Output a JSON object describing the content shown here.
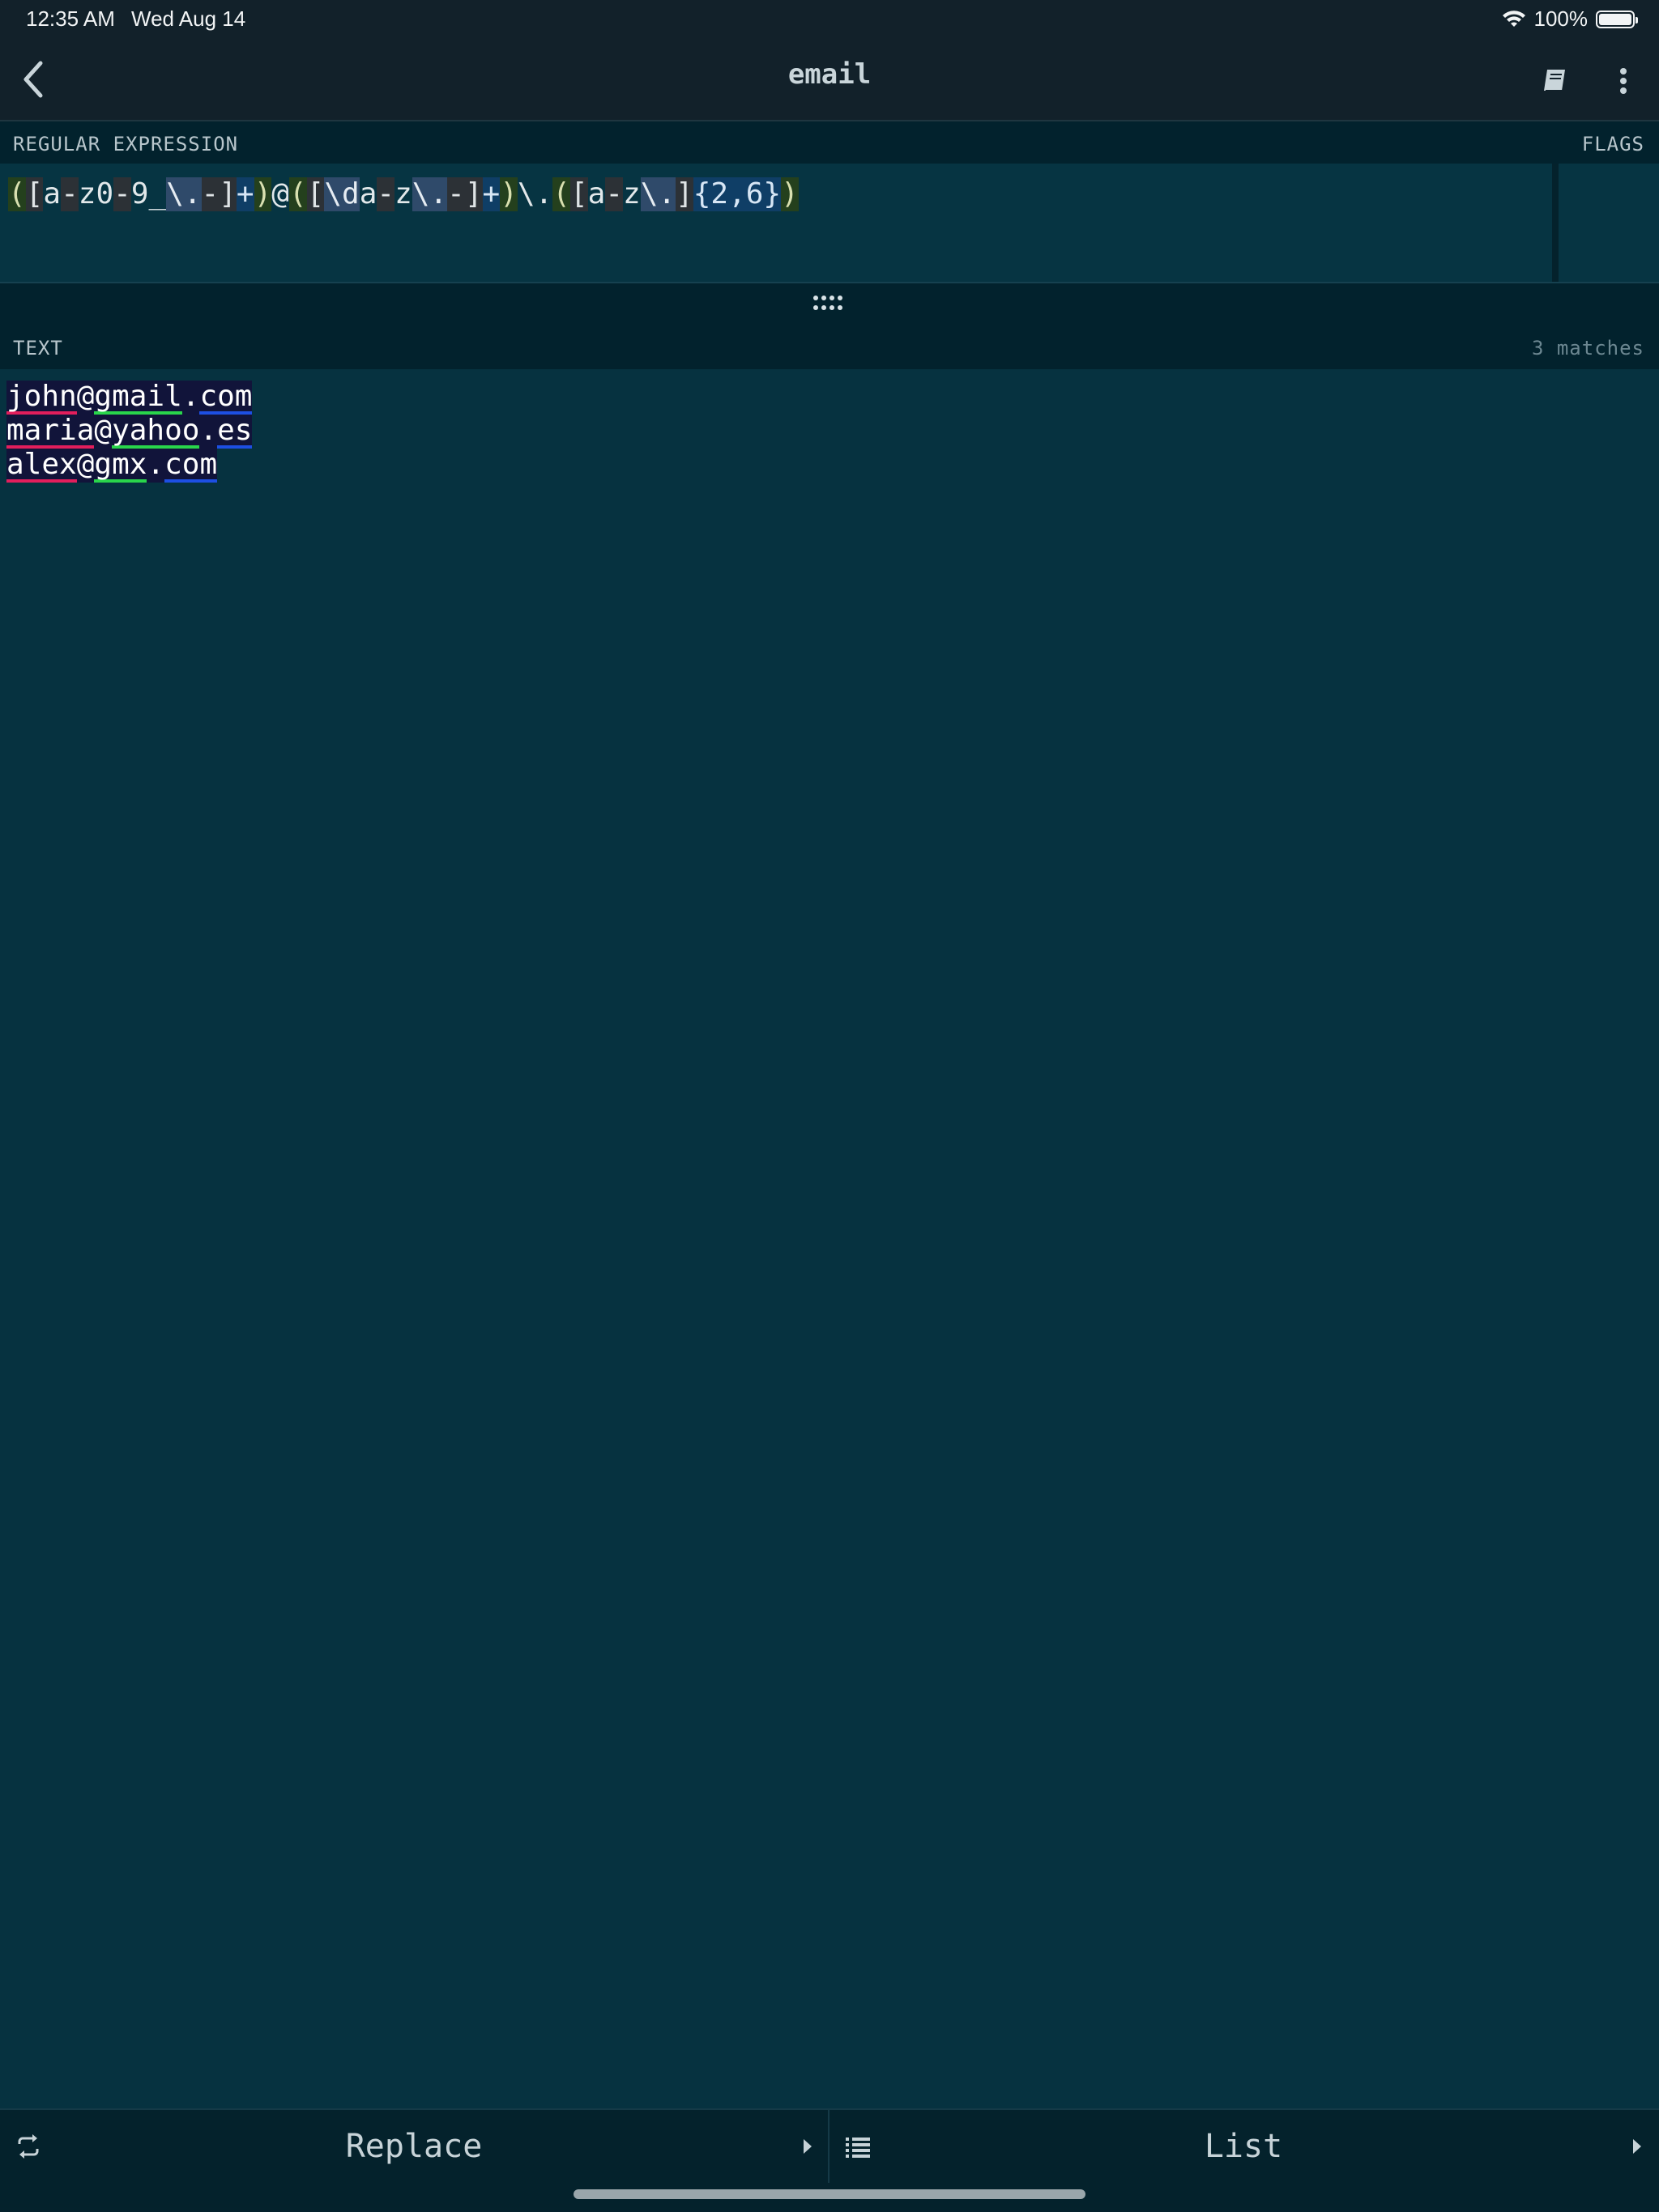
{
  "status_bar": {
    "time": "12:35 AM",
    "date": "Wed Aug 14",
    "battery": "100%",
    "icons": [
      "wifi-icon",
      "battery-icon"
    ]
  },
  "nav": {
    "title": "email",
    "icons": [
      "back-chevron-icon",
      "book-icon",
      "more-vertical-icon"
    ]
  },
  "regex_section": {
    "label": "REGULAR EXPRESSION",
    "flags_label": "FLAGS"
  },
  "regex_tokens": [
    {
      "t": "(",
      "k": "grp"
    },
    {
      "t": "[",
      "k": "br"
    },
    {
      "t": "a",
      "k": "plain"
    },
    {
      "t": "-",
      "k": "br"
    },
    {
      "t": "z",
      "k": "plain"
    },
    {
      "t": "0",
      "k": "plain"
    },
    {
      "t": "-",
      "k": "br"
    },
    {
      "t": "9",
      "k": "plain"
    },
    {
      "t": "_",
      "k": "plain"
    },
    {
      "t": "\\.",
      "k": "esc"
    },
    {
      "t": "-",
      "k": "br"
    },
    {
      "t": "]",
      "k": "br"
    },
    {
      "t": "+",
      "k": "q"
    },
    {
      "t": ")",
      "k": "grp"
    },
    {
      "t": "@",
      "k": "plain"
    },
    {
      "t": "(",
      "k": "grp"
    },
    {
      "t": "[",
      "k": "br"
    },
    {
      "t": "\\d",
      "k": "esc"
    },
    {
      "t": "a",
      "k": "plain"
    },
    {
      "t": "-",
      "k": "br"
    },
    {
      "t": "z",
      "k": "plain"
    },
    {
      "t": "\\.",
      "k": "esc"
    },
    {
      "t": "-",
      "k": "br"
    },
    {
      "t": "]",
      "k": "br"
    },
    {
      "t": "+",
      "k": "q"
    },
    {
      "t": ")",
      "k": "grp"
    },
    {
      "t": "\\.",
      "k": "plain"
    },
    {
      "t": "(",
      "k": "grp"
    },
    {
      "t": "[",
      "k": "br"
    },
    {
      "t": "a",
      "k": "plain"
    },
    {
      "t": "-",
      "k": "br"
    },
    {
      "t": "z",
      "k": "plain"
    },
    {
      "t": "\\.",
      "k": "esc"
    },
    {
      "t": "]",
      "k": "br"
    },
    {
      "t": "{2,6}",
      "k": "q"
    },
    {
      "t": ")",
      "k": "grp"
    }
  ],
  "text_section": {
    "label": "TEXT",
    "matches": "3 matches"
  },
  "text_lines": [
    [
      {
        "t": "john",
        "g": 1
      },
      {
        "t": "@",
        "g": 0
      },
      {
        "t": "gmail",
        "g": 2
      },
      {
        "t": ".",
        "g": 0
      },
      {
        "t": "com",
        "g": 3
      }
    ],
    [
      {
        "t": "maria",
        "g": 1
      },
      {
        "t": "@",
        "g": 0
      },
      {
        "t": "yahoo",
        "g": 2
      },
      {
        "t": ".",
        "g": 0
      },
      {
        "t": "es",
        "g": 3
      }
    ],
    [
      {
        "t": "alex",
        "g": 1
      },
      {
        "t": "@",
        "g": 0
      },
      {
        "t": "gmx",
        "g": 2
      },
      {
        "t": ".",
        "g": 0
      },
      {
        "t": "com",
        "g": 3
      }
    ]
  ],
  "bottom_bar": {
    "replace_label": "Replace",
    "list_label": "List",
    "icons": [
      "repeat-icon",
      "list-icon",
      "triangle-right-icon"
    ]
  },
  "colors": {
    "group1": "#e31e5c",
    "group2": "#29d64b",
    "group3": "#1d4fe3",
    "background": "#063240"
  }
}
